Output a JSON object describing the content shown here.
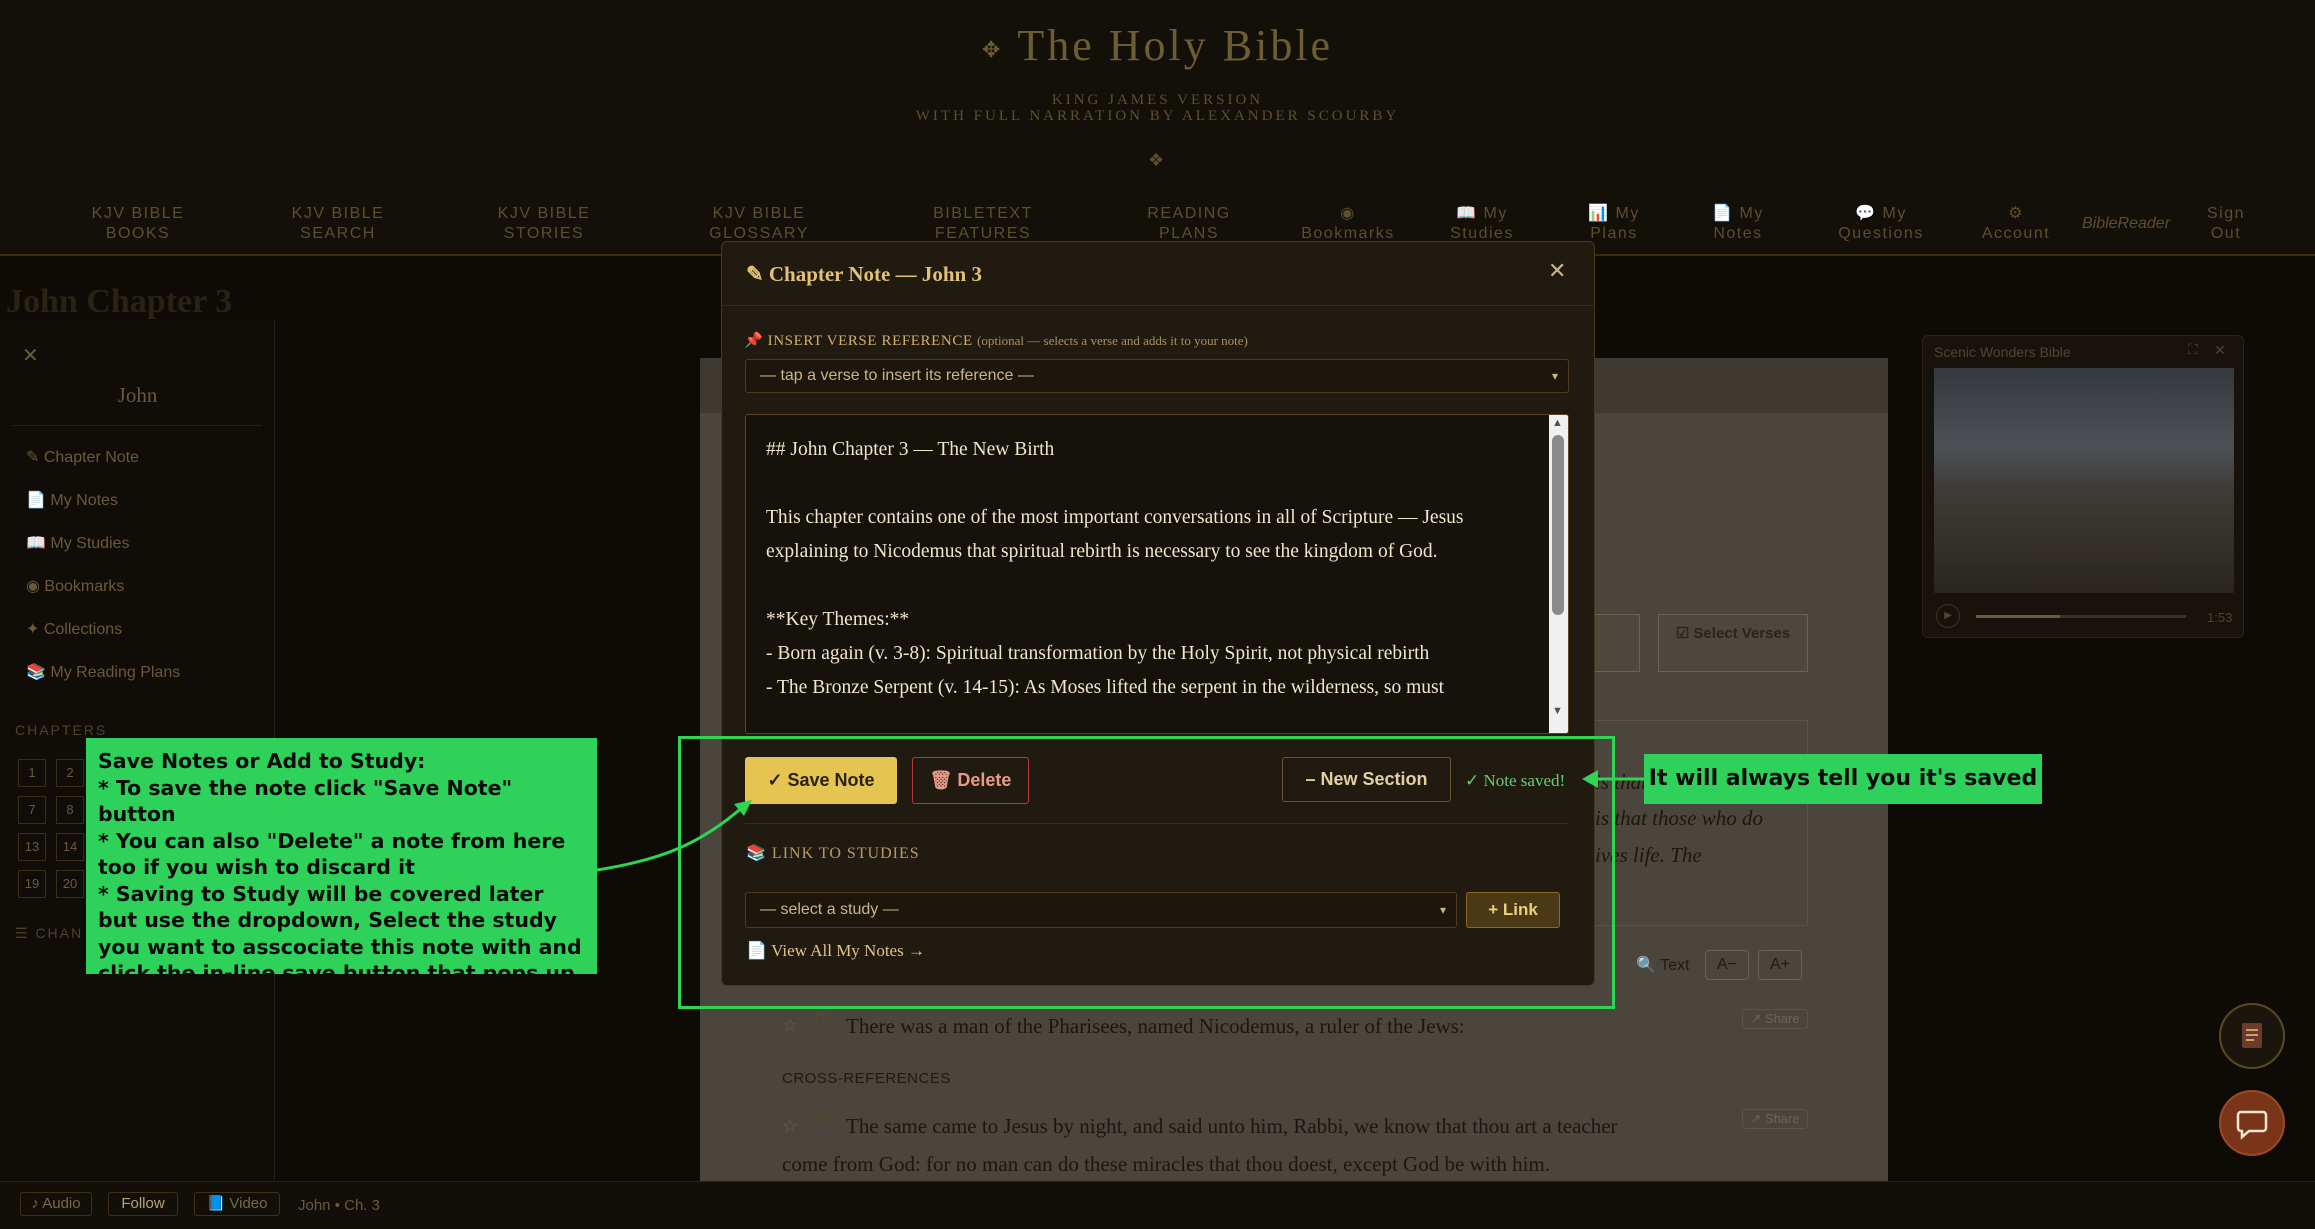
{
  "header": {
    "title": "The Holy Bible",
    "subtitle1": "KING JAMES VERSION",
    "subtitle2": "WITH FULL NARRATION BY ALEXANDER SCOURBY",
    "ornament": "❖",
    "title_ornament": "✥"
  },
  "nav": [
    {
      "l1": "KJV BIBLE",
      "l2": "BOOKS"
    },
    {
      "l1": "KJV BIBLE",
      "l2": "SEARCH"
    },
    {
      "l1": "KJV BIBLE",
      "l2": "STORIES"
    },
    {
      "l1": "KJV BIBLE",
      "l2": "GLOSSARY"
    },
    {
      "l1": "BIBLETEXT",
      "l2": "FEATURES"
    },
    {
      "l1": "READING",
      "l2": "PLANS"
    },
    {
      "l1": "◉",
      "l2": "Bookmarks"
    },
    {
      "l1": "📖 My",
      "l2": "Studies"
    },
    {
      "l1": "📊 My",
      "l2": "Plans"
    },
    {
      "l1": "📄 My",
      "l2": "Notes"
    },
    {
      "l1": "💬 My",
      "l2": "Questions"
    },
    {
      "l1": "⚙",
      "l2": "Account"
    },
    {
      "l1": "BibleReader",
      "l2": ""
    },
    {
      "l1": "Sign",
      "l2": "Out"
    }
  ],
  "page": {
    "ghost_title": "John Chapter 3"
  },
  "sidebar": {
    "close": "✕",
    "book": "John",
    "items": [
      "✎ Chapter Note",
      "📄 My Notes",
      "📖 My Studies",
      "◉ Bookmarks",
      "✦ Collections",
      "📚 My Reading Plans"
    ],
    "chapters_label": "CHAPTERS",
    "chapters_label2": "☰ CHAN",
    "chapters": [
      "1",
      "2",
      "7",
      "8",
      "13",
      "14",
      "19",
      "20"
    ]
  },
  "reader": {
    "select_verses": "☑ Select Verses",
    "partial1": "is that th",
    "partial2": "is that those who do",
    "partial3": "ives life. The",
    "text_btn": "🔍 Text",
    "a_minus": "A−",
    "a_plus": "A+",
    "verses": [
      {
        "star": "☆",
        "num": "(1)",
        "text": "There was a man of the Pharisees, named Nicodemus, a ruler of the Jews:"
      },
      {
        "star": "☆",
        "num": "(2)",
        "text": "The same came to Jesus by night, and said unto him, Rabbi, we know that thou art a teacher"
      }
    ],
    "verse2_cont": "come from God: for no man can do these miracles that thou doest, except God be with him.",
    "cross_refs": "CROSS-REFERENCES",
    "share": "↗ Share"
  },
  "video": {
    "title": "Scenic Wonders Bible",
    "time": "1:53",
    "expand": "⛶",
    "close": "✕",
    "play": "▶"
  },
  "bottom": {
    "audio": "♪ Audio",
    "follow": "Follow",
    "video": "📘 Video",
    "location": "John • Ch. 3"
  },
  "modal": {
    "title": "✎ Chapter Note — John 3",
    "close": "✕",
    "insert_label": "📌 INSERT VERSE REFERENCE",
    "insert_hint": "(optional — selects a verse and adds it to your note)",
    "verse_select": "— tap a verse to insert its reference —",
    "note_text": "## John Chapter 3 — The New Birth\n\nThis chapter contains one of the most important conversations in all of Scripture — Jesus explaining to Nicodemus that spiritual rebirth is necessary to see the kingdom of God.\n\n**Key Themes:**\n- Born again (v. 3-8): Spiritual transformation by the Holy Spirit, not physical rebirth\n- The Bronze Serpent (v. 14-15): As Moses lifted the serpent in the wilderness, so must",
    "save": "✓ Save Note",
    "delete": "🗑 Delete",
    "new_section": "– New Section",
    "saved": "✓ Note saved!",
    "link_label": "📚 LINK TO STUDIES",
    "study_select": "— select a study —",
    "link_btn": "+ Link",
    "view_all": "📄 View All My Notes →"
  },
  "annotations": {
    "left": [
      "Save Notes or Add to Study:",
      "* To save the note click \"Save Note\" button",
      "* You can also \"Delete\" a note from here too if you wish to discard it",
      "* Saving to Study will be covered later but use the dropdown,  Select the study you want to asscociate this note with and click the in-line save button that pops up"
    ],
    "right": "It will always tell you it's saved"
  },
  "colors": {
    "accent": "#e5c451",
    "annotation": "#2ed25a",
    "danger": "#b63a36",
    "saved": "#5fd070"
  }
}
